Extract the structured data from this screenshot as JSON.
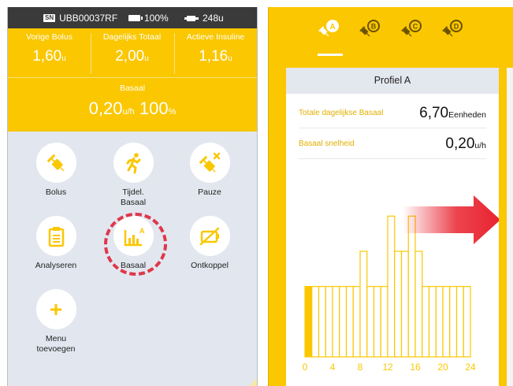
{
  "left_screen": {
    "status_bar": {
      "sn_badge": "SN",
      "serial": "UBB00037RF",
      "battery": "100%",
      "insulin": "248u"
    },
    "stats": [
      {
        "label": "Vorige Bolus",
        "value": "1,60",
        "unit": "u"
      },
      {
        "label": "Dagelijks Totaal",
        "value": "2,00",
        "unit": "u"
      },
      {
        "label": "Actieve Insuline",
        "value": "1,16",
        "unit": "u"
      }
    ],
    "basal": {
      "label": "Basaal",
      "rate": "0,20",
      "rate_unit": "u/h",
      "percent": "100",
      "percent_unit": "%"
    },
    "menu": [
      {
        "label_lines": [
          "Bolus"
        ],
        "icon": "syringe-icon"
      },
      {
        "label_lines": [
          "Tijdel.",
          "Basaal"
        ],
        "icon": "running-person-icon"
      },
      {
        "label_lines": [
          "Pauze"
        ],
        "icon": "pause-syringe-icon"
      },
      {
        "label_lines": [
          "Analyseren"
        ],
        "icon": "clipboard-icon"
      },
      {
        "label_lines": [
          "Basaal"
        ],
        "icon": "basal-chart-icon",
        "badge": "A"
      },
      {
        "label_lines": [
          "Ontkoppel"
        ],
        "icon": "disconnect-icon"
      },
      {
        "label_lines": [
          "Menu",
          "toevoegen"
        ],
        "icon": "plus-icon"
      }
    ],
    "highlighted_item": "Basaal"
  },
  "right_screen": {
    "profile_tabs": [
      {
        "letter": "A",
        "selected": true
      },
      {
        "letter": "B",
        "selected": false
      },
      {
        "letter": "C",
        "selected": false
      },
      {
        "letter": "D",
        "selected": false
      }
    ],
    "card_title": "Profiel A",
    "rows": [
      {
        "label": "Totale dagelijkse Basaal",
        "value": "6,70",
        "unit": "Eenheden"
      },
      {
        "label": "Basaal snelheid",
        "value": "0,20",
        "unit": "u/h"
      }
    ]
  },
  "colors": {
    "accent_yellow": "#fac700",
    "highlight_red": "#e0364b",
    "arrow_red": "#e8232f"
  },
  "chart_data": {
    "type": "bar",
    "x_tick_labels": [
      "0",
      "4",
      "8",
      "12",
      "16",
      "20",
      "24"
    ],
    "xlim": [
      0,
      24
    ],
    "hours": [
      0,
      1,
      2,
      3,
      4,
      5,
      6,
      7,
      8,
      9,
      10,
      11,
      12,
      13,
      14,
      15,
      16,
      17,
      18,
      19,
      20,
      21,
      22,
      23
    ],
    "values": [
      0.2,
      0.2,
      0.2,
      0.2,
      0.2,
      0.2,
      0.2,
      0.2,
      0.3,
      0.2,
      0.2,
      0.2,
      0.4,
      0.3,
      0.3,
      0.4,
      0.3,
      0.2,
      0.2,
      0.2,
      0.2,
      0.2,
      0.2,
      0.2
    ],
    "ylim": [
      0,
      0.45
    ],
    "current_hour": 0
  }
}
